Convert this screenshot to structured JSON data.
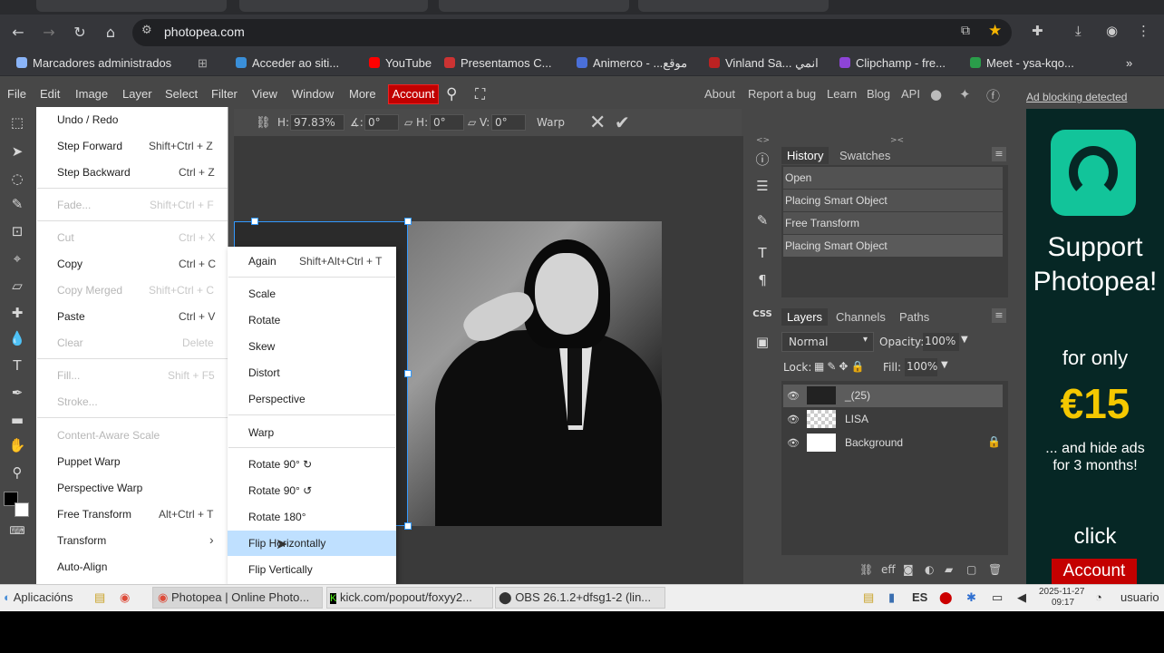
{
  "browser": {
    "url": "photopea.com",
    "bookmarks": [
      {
        "label": "Marcadores administrados",
        "icon": "folder-icon"
      },
      {
        "label": "Acceder ao siti...",
        "icon": "site-icon"
      },
      {
        "label": "YouTube",
        "icon": "youtube-icon"
      },
      {
        "label": "Presentamos C...",
        "icon": "site-icon"
      },
      {
        "label": "Animerco - ...موقع",
        "icon": "site-icon"
      },
      {
        "label": "Vinland Sa... انمي",
        "icon": "site-icon"
      },
      {
        "label": "Clipchamp - fre...",
        "icon": "clipchamp-icon"
      },
      {
        "label": "Meet - ysa-kqo...",
        "icon": "meet-icon"
      }
    ],
    "more_bookmarks": "»"
  },
  "menubar": {
    "items": [
      "File",
      "Edit",
      "Image",
      "Layer",
      "Select",
      "Filter",
      "View",
      "Window",
      "More"
    ],
    "account": "Account",
    "right_links": [
      "About",
      "Report a bug",
      "Learn",
      "Blog",
      "API"
    ]
  },
  "options": {
    "h_label": "H:",
    "h_value": "97.83%",
    "angle_label": "∡:",
    "angle_value": "0°",
    "skew_h_label": "▱ H:",
    "skew_h_value": "0°",
    "skew_v_label": "▱ V:",
    "skew_v_value": "0°",
    "warp": "Warp"
  },
  "edit_menu": {
    "items": [
      {
        "label": "Undo / Redo",
        "key": "",
        "disabled": false
      },
      {
        "label": "Step Forward",
        "key": "Shift+Ctrl + Z",
        "disabled": false
      },
      {
        "label": "Step Backward",
        "key": "Ctrl + Z",
        "disabled": false
      },
      {
        "label": "Fade...",
        "key": "Shift+Ctrl + F",
        "disabled": true
      },
      {
        "label": "Cut",
        "key": "Ctrl + X",
        "disabled": true
      },
      {
        "label": "Copy",
        "key": "Ctrl + C",
        "disabled": false
      },
      {
        "label": "Copy Merged",
        "key": "Shift+Ctrl + C",
        "disabled": true
      },
      {
        "label": "Paste",
        "key": "Ctrl + V",
        "disabled": false
      },
      {
        "label": "Clear",
        "key": "Delete",
        "disabled": true
      },
      {
        "label": "Fill...",
        "key": "Shift + F5",
        "disabled": true
      },
      {
        "label": "Stroke...",
        "key": "",
        "disabled": true
      },
      {
        "label": "Content-Aware Scale",
        "key": "",
        "disabled": true
      },
      {
        "label": "Puppet Warp",
        "key": "",
        "disabled": false
      },
      {
        "label": "Perspective Warp",
        "key": "",
        "disabled": false
      },
      {
        "label": "Free Transform",
        "key": "Alt+Ctrl + T",
        "disabled": false
      },
      {
        "label": "Transform",
        "key": "›",
        "disabled": false
      },
      {
        "label": "Auto-Align",
        "key": "",
        "disabled": false
      }
    ]
  },
  "transform_menu": {
    "again": "Again",
    "again_key": "Shift+Alt+Ctrl + T",
    "items": [
      "Scale",
      "Rotate",
      "Skew",
      "Distort",
      "Perspective",
      "Warp",
      "Rotate 90° ↻",
      "Rotate 90° ↺",
      "Rotate 180°",
      "Flip Horizontally",
      "Flip Vertically"
    ],
    "highlighted": "Flip Horizontally"
  },
  "history_panel": {
    "tabs": [
      "History",
      "Swatches"
    ],
    "items": [
      "Open",
      "Placing Smart Object",
      "Free Transform",
      "Placing Smart Object"
    ]
  },
  "layers_panel": {
    "tabs": [
      "Layers",
      "Channels",
      "Paths"
    ],
    "blend_mode": "Normal",
    "opacity_label": "Opacity:",
    "opacity": "100%",
    "lock_label": "Lock:",
    "fill_label": "Fill:",
    "fill": "100%",
    "layers": [
      {
        "name": "_(25)",
        "selected": true
      },
      {
        "name": "LISA",
        "selected": false
      },
      {
        "name": "Background",
        "selected": false,
        "locked": true
      }
    ],
    "footer_eff": "eff"
  },
  "ad": {
    "adblock": "Ad blocking detected",
    "line1": "Support",
    "line2": "Photopea!",
    "line3": "for only",
    "price": "€15",
    "line4": "... and hide ads",
    "line5": "for 3 months!",
    "click": "click",
    "account": "Account"
  },
  "taskbar": {
    "start": "Aplicacións",
    "windows": [
      "Photopea | Online Photo...",
      "kick.com/popout/foxyy2...",
      "OBS 26.1.2+dfsg1-2 (lin..."
    ],
    "lang": "ES",
    "date": "2025-11-27",
    "time": "09:17",
    "user": "usuario"
  },
  "colors": {
    "accent": "#c10000",
    "highlight": "#bfe0ff",
    "ad_bg": "#062725",
    "ad_logo": "#12c49a",
    "price": "#f5c800"
  }
}
